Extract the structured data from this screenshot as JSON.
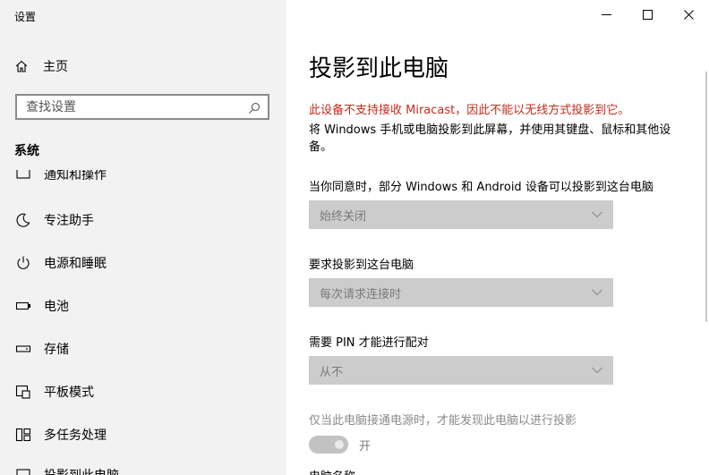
{
  "window": {
    "title": "设置"
  },
  "sidebar": {
    "home_label": "主页",
    "search_placeholder": "查找设置",
    "section_title": "系统",
    "clipped_top_label": "通知和操作",
    "items": [
      {
        "label": "专注助手",
        "icon": "moon-icon"
      },
      {
        "label": "电源和睡眠",
        "icon": "power-icon"
      },
      {
        "label": "电池",
        "icon": "battery-icon"
      },
      {
        "label": "存储",
        "icon": "storage-icon"
      },
      {
        "label": "平板模式",
        "icon": "tablet-mode-icon"
      },
      {
        "label": "多任务处理",
        "icon": "multitasking-icon"
      }
    ],
    "clipped_bottom_label": "投影到此电脑"
  },
  "main": {
    "title": "投影到此电脑",
    "warning": "此设备不支持接收 Miracast，因此不能以无线方式投影到它。",
    "description": "将 Windows 手机或电脑投影到此屏幕，并使用其键盘、鼠标和其他设备。",
    "setting1_label": "当你同意时，部分 Windows 和 Android 设备可以投影到这台电脑",
    "setting1_value": "始终关闭",
    "setting2_label": "要求投影到这台电脑",
    "setting2_value": "每次请求连接时",
    "setting3_label": "需要 PIN 才能进行配对",
    "setting3_value": "从不",
    "setting4_label": "仅当此电脑接通电源时，才能发现此电脑以进行投影",
    "toggle_state": "开",
    "clipped_bottom_label": "电脑名称"
  },
  "colors": {
    "warning": "#c42b1c",
    "sidebar_bg": "#f2f2f2",
    "dropdown_bg": "#cccccc"
  }
}
